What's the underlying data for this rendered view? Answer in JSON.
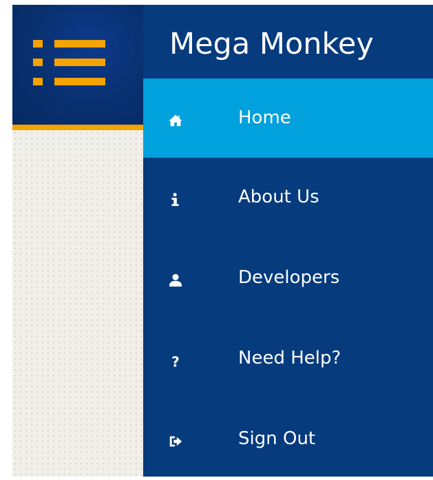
{
  "brand": {
    "title": "Mega Monkey",
    "accent_color": "#f5a300",
    "panel_color": "#063b7e",
    "active_color": "#00a1dd"
  },
  "menu": {
    "items": [
      {
        "label": "Home",
        "icon": "home-icon",
        "active": true
      },
      {
        "label": "About Us",
        "icon": "info-icon",
        "active": false
      },
      {
        "label": "Developers",
        "icon": "user-icon",
        "active": false
      },
      {
        "label": "Need Help?",
        "icon": "question-icon",
        "active": false
      },
      {
        "label": "Sign Out",
        "icon": "sign-out-icon",
        "active": false
      }
    ]
  }
}
